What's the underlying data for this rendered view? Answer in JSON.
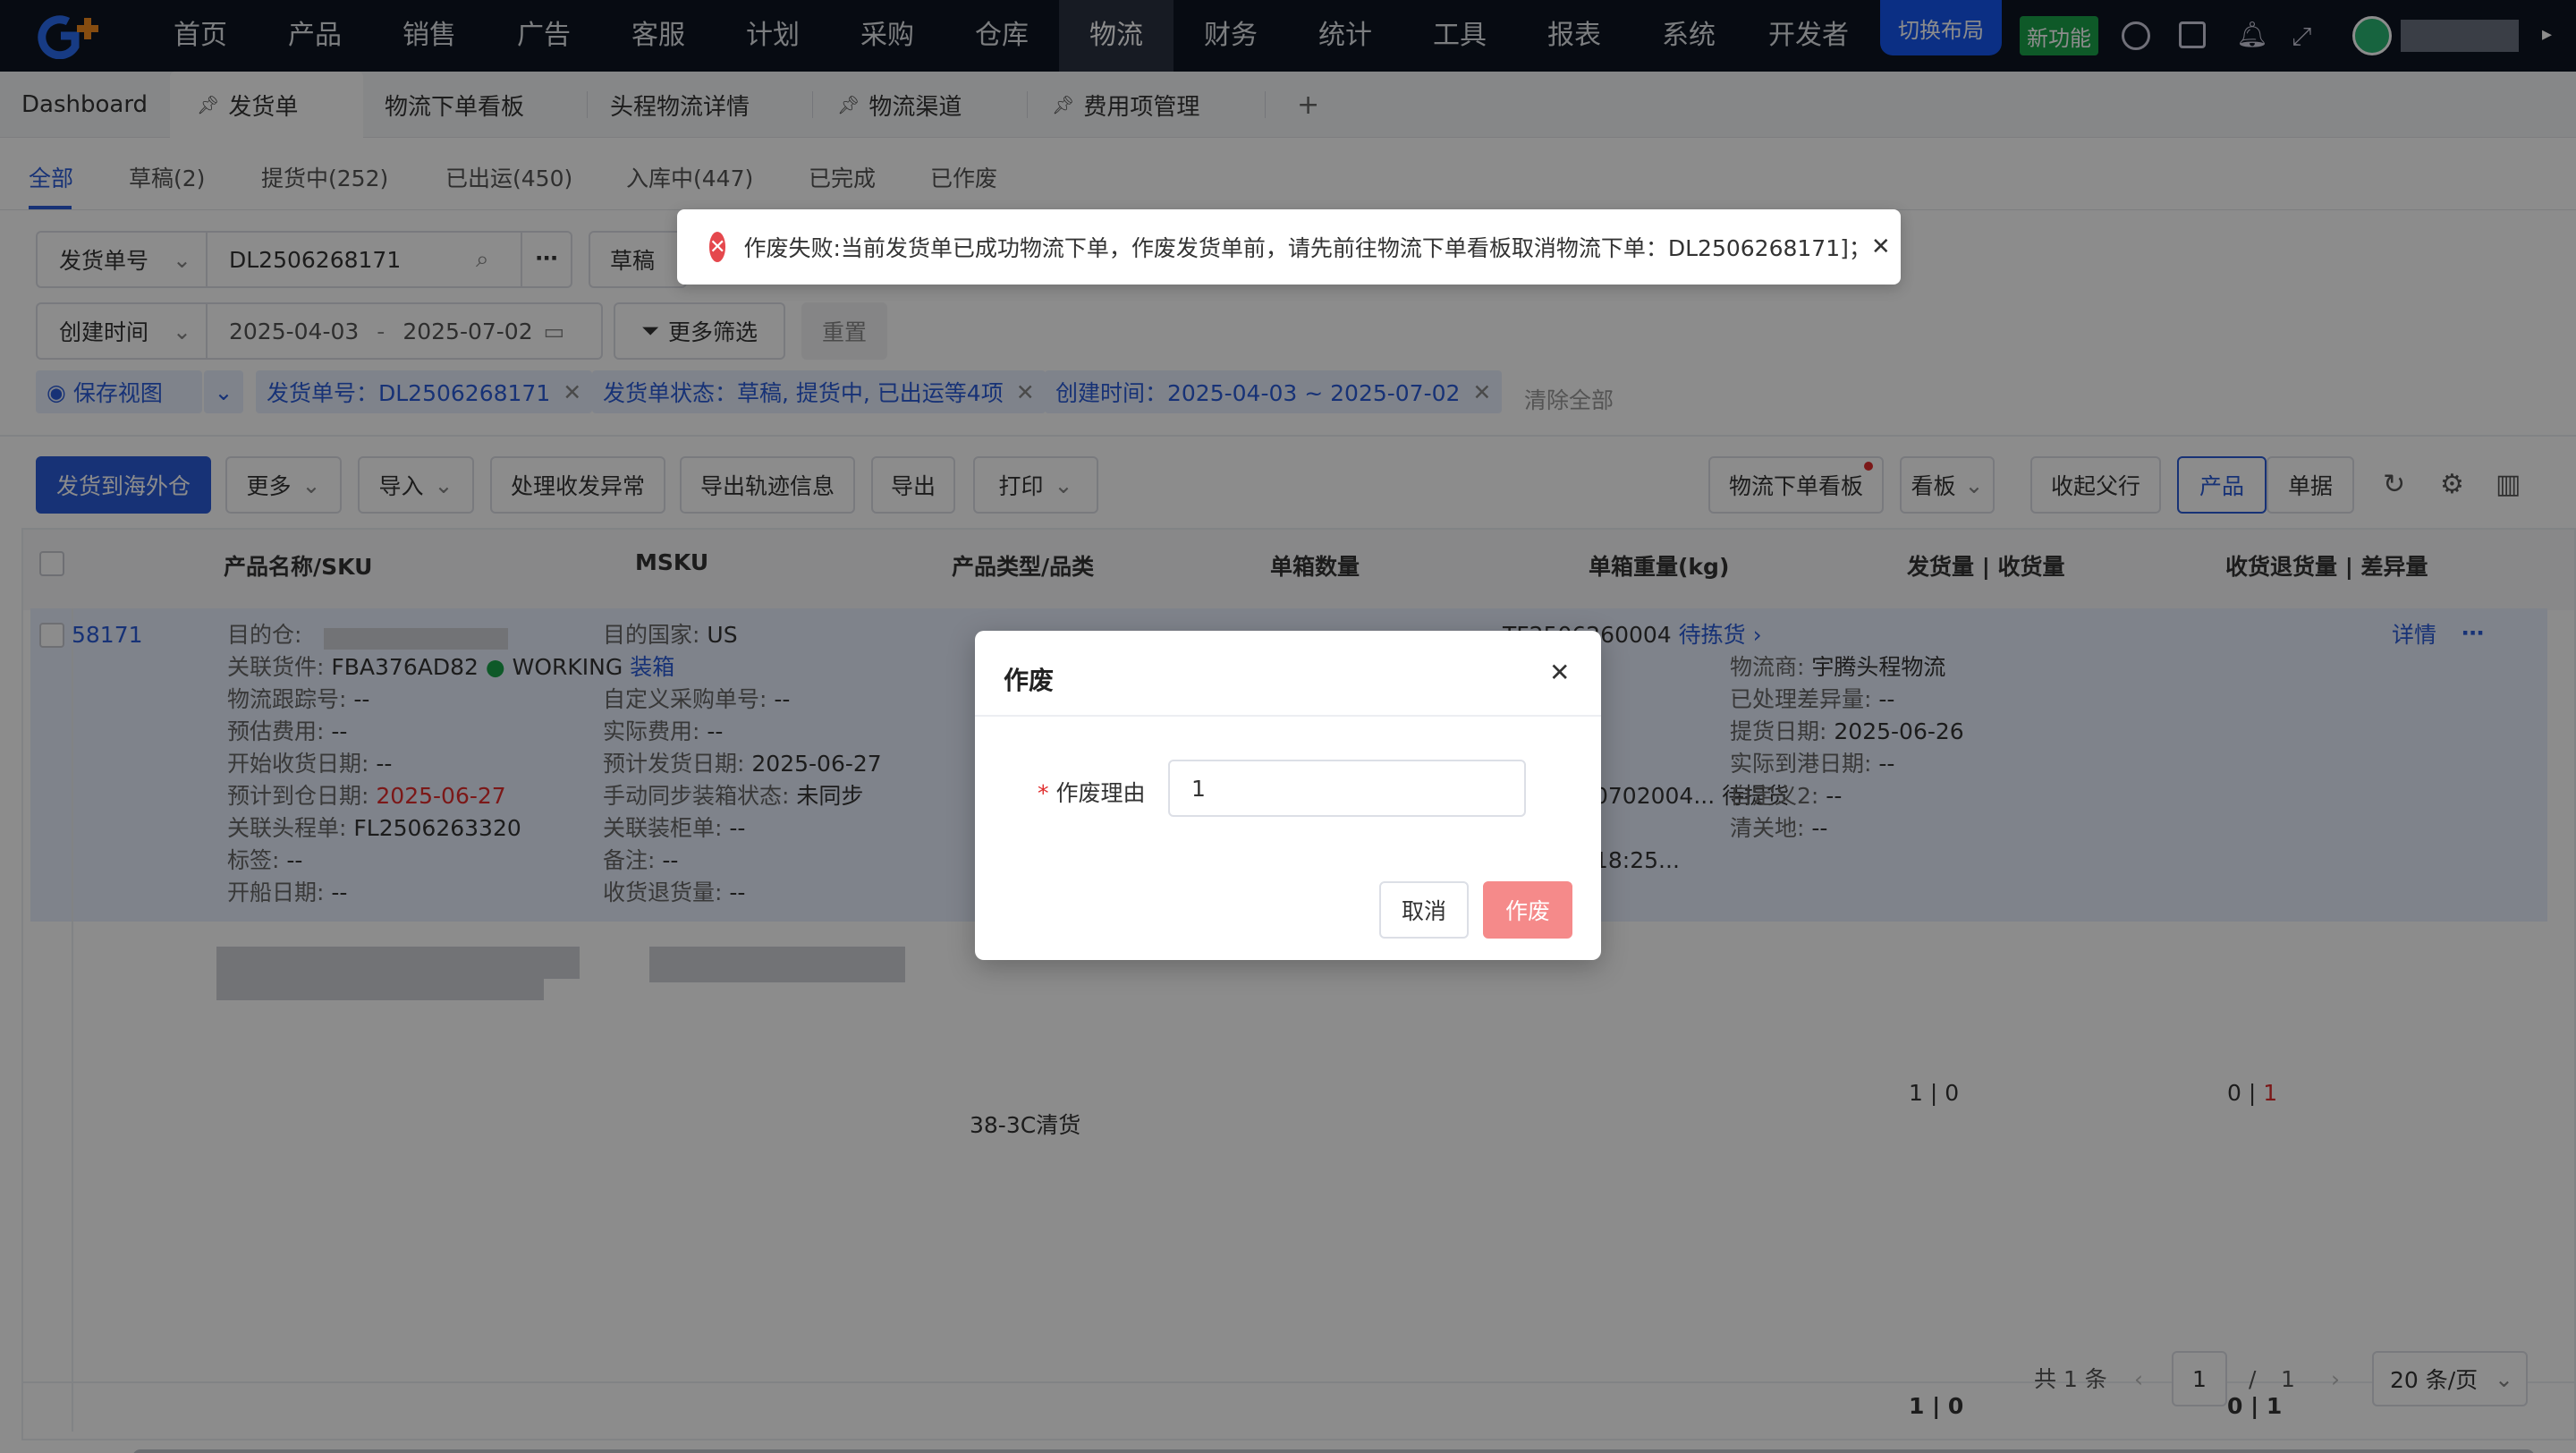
{
  "nav": {
    "items": [
      "首页",
      "产品",
      "销售",
      "广告",
      "客服",
      "计划",
      "采购",
      "仓库",
      "物流",
      "财务",
      "统计",
      "工具",
      "报表",
      "系统",
      "开发者"
    ],
    "active": "物流",
    "switch_layout": "切换布局",
    "new_feature": "新功能"
  },
  "page_tabs": [
    {
      "label": "Dashboard"
    },
    {
      "label": "发货单"
    },
    {
      "label": "物流下单看板"
    },
    {
      "label": "头程物流详情"
    },
    {
      "label": "物流渠道"
    },
    {
      "label": "费用项管理"
    }
  ],
  "status_tabs": [
    "全部",
    "草稿(2)",
    "提货中(252)",
    "已出运(450)",
    "入库中(447)",
    "已完成",
    "已作废"
  ],
  "filters": {
    "field1": "发货单号",
    "value1": "DL2506268171",
    "field2": "草稿",
    "date_field": "创建时间",
    "date_start": "2025-04-03",
    "date_sep": "-",
    "date_end": "2025-07-02",
    "more_filter": "更多筛选",
    "reset": "重置"
  },
  "chips": {
    "save_view": "保存视图",
    "c1": "发货单号：DL2506268171",
    "c2": "发货单状态：草稿, 提货中, 已出运等4项",
    "c3": "创建时间：2025-04-03 ~ 2025-07-02",
    "clear": "清除全部"
  },
  "toolbar": {
    "ship": "发货到海外仓",
    "more": "更多",
    "import": "导入",
    "handle": "处理收发异常",
    "export_track": "导出轨迹信息",
    "export": "导出",
    "print": "打印",
    "logistics_board": "物流下单看板",
    "board": "看板",
    "collapse": "收起父行",
    "product": "产品",
    "doc": "单据"
  },
  "table": {
    "headers": [
      "产品名称/SKU",
      "MSKU",
      "产品类型/品类",
      "单箱数量",
      "单箱重量(kg)",
      "发货量 | 收货量",
      "收货退货量 | 差异量"
    ],
    "row": {
      "id": "58171",
      "col1": [
        [
          "目的仓:",
          ""
        ],
        [
          "关联货件:",
          "FBA376AD82"
        ],
        [
          "物流跟踪号:",
          "--"
        ],
        [
          "预估费用:",
          "--"
        ],
        [
          "开始收货日期:",
          "--"
        ],
        [
          "预计到仓日期:",
          "2025-06-27"
        ],
        [
          "关联头程单:",
          "FL2506263320"
        ],
        [
          "标签:",
          "--"
        ],
        [
          "开船日期:",
          "--"
        ]
      ],
      "working": "WORKING",
      "ship_link": "装箱",
      "col2": [
        [
          "目的国家:",
          "US"
        ],
        [
          "自定义采购单号:",
          "--"
        ],
        [
          "实际费用:",
          "--"
        ],
        [
          "预计发货日期:",
          "2025-06-27"
        ],
        [
          "手动同步装箱状态:",
          "未同步"
        ],
        [
          "关联装柜单:",
          "--"
        ],
        [
          "备注:",
          "--"
        ],
        [
          "收货退货量:",
          "--"
        ]
      ],
      "col3a": "TF2506260004",
      "pending": "待拣货",
      "col3b": "0702004...",
      "pending2": "待提货",
      "col3c": "18:25...",
      "col4": [
        [
          "物流商:",
          "宇腾头程物流"
        ],
        [
          "已处理差异量:",
          "--"
        ],
        [
          "提货日期:",
          "2025-06-26"
        ],
        [
          "实际到港日期:",
          "--"
        ],
        [
          "自定义2:",
          "--"
        ],
        [
          "清关地:",
          "--"
        ]
      ],
      "detail": "详情"
    },
    "sub_row": {
      "category": "38-3C清货",
      "ship": "1",
      "recv": "0",
      "ret": "0",
      "diff": "1"
    },
    "total": {
      "a": "1 | 0",
      "b": "0 | 1"
    }
  },
  "pagination": {
    "total": "共 1 条",
    "page": "1",
    "sep": "/",
    "pages": "1",
    "size": "20 条/页"
  },
  "toast": {
    "text": "作废失败:当前发货单已成功物流下单，作废发货单前，请先前往物流下单看板取消物流下单：DL2506268171]；"
  },
  "modal": {
    "title": "作废",
    "label": "作废理由",
    "value": "1",
    "cancel": "取消",
    "confirm": "作废"
  }
}
